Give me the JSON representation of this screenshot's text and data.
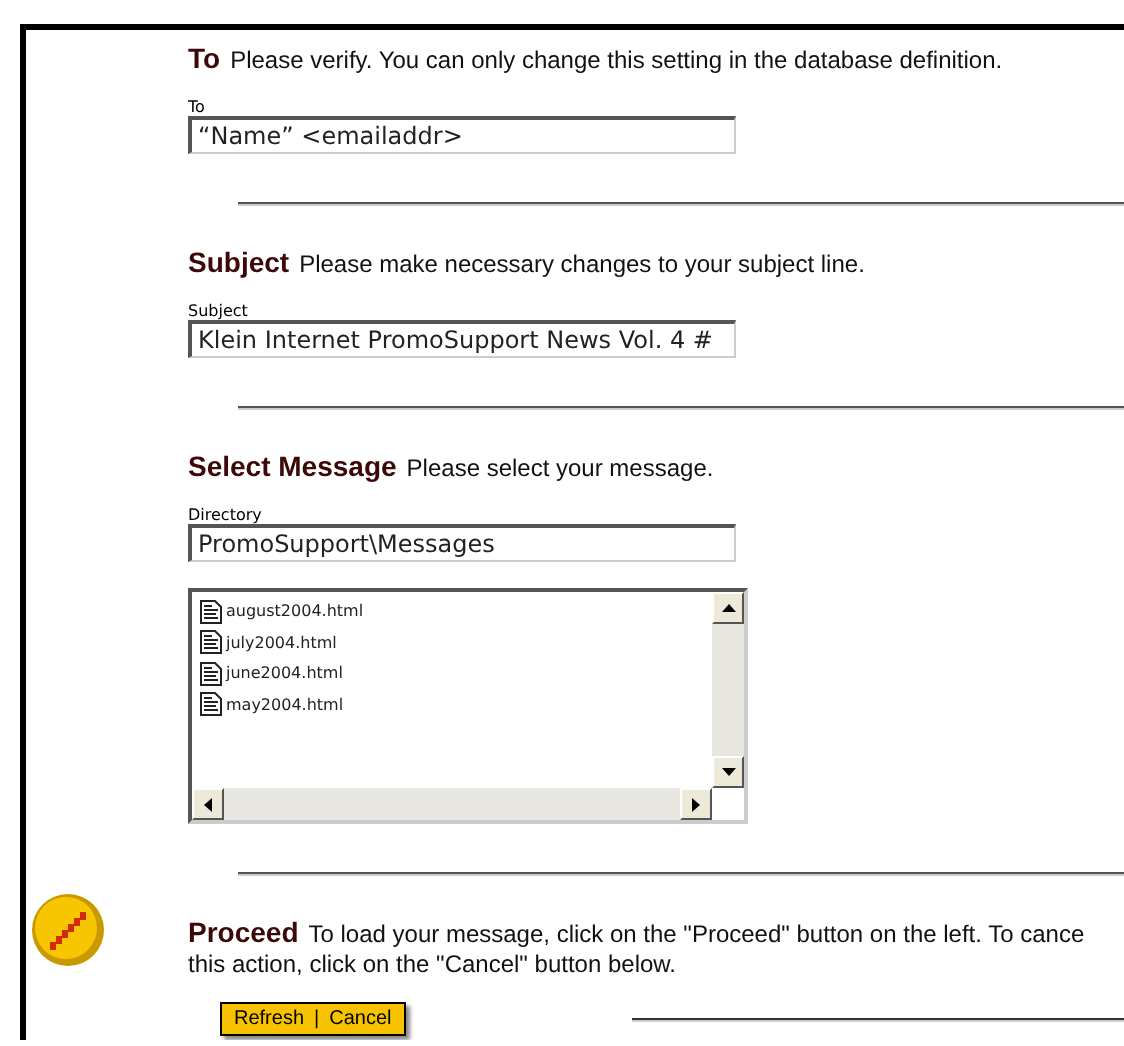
{
  "sections": [
    {
      "kind": "field",
      "heading": "To",
      "description": "Please verify. You can only change this setting in the database definition.",
      "field": {
        "label": "To",
        "value": "“Name” <emailaddr>"
      }
    },
    {
      "kind": "field",
      "heading": "Subject",
      "description": "Please make necessary changes to your subject line.",
      "field": {
        "label": "Subject",
        "value": "Klein Internet PromoSupport News Vol. 4 #"
      }
    },
    {
      "kind": "files",
      "heading": "Select Message",
      "description": "Please select your message.",
      "field": {
        "label": "Directory",
        "value": "PromoSupport\\Messages"
      },
      "files": [
        {
          "name": "august2004.html",
          "selected": false
        },
        {
          "name": "july2004.html",
          "selected": false
        },
        {
          "name": "june2004.html",
          "selected": false
        },
        {
          "name": "may2004.html",
          "selected": false
        }
      ]
    },
    {
      "kind": "proceed",
      "heading": "Proceed",
      "lines": [
        "To load your message, click on the \"Proceed\" button on the left. To cance",
        "this action, click on the \"Cancel\" button below."
      ],
      "actions": [
        "Refresh",
        "|",
        "Cancel"
      ]
    }
  ]
}
